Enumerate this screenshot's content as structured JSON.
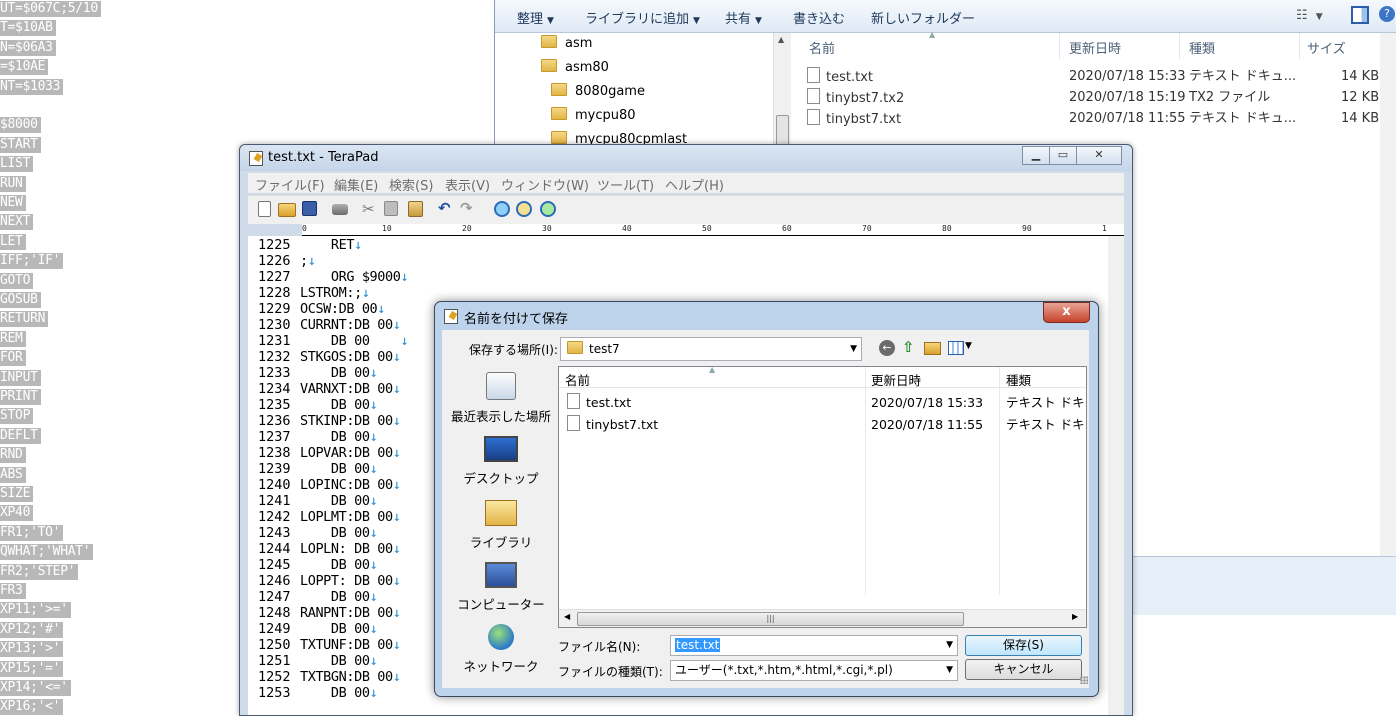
{
  "left_column": {
    "lines": [
      "UT=$067C;5/10",
      "T=$10AB",
      "N=$06A3",
      "=$10AE",
      "NT=$1033",
      "",
      "$8000",
      "START",
      "LIST",
      "RUN",
      "NEW",
      "NEXT",
      "LET",
      "IFF;'IF'",
      "GOTO",
      "GOSUB",
      "RETURN",
      "REM",
      "FOR",
      "INPUT",
      "PRINT",
      "STOP",
      "DEFLT",
      "RND",
      "ABS",
      "SIZE",
      "XP40",
      "FR1;'TO'",
      "QWHAT;'WHAT'",
      "FR2;'STEP'",
      "FR3",
      "XP11;'>='",
      "XP12;'#'",
      "XP13;'>'",
      "XP15;'='",
      "XP14;'<='",
      "XP16;'<'"
    ]
  },
  "explorer": {
    "toolbar": {
      "organize": "整理",
      "add_to_library": "ライブラリに追加",
      "share": "共有",
      "burn": "書き込む",
      "new_folder": "新しいフォルダー"
    },
    "tree": [
      "asm",
      "asm80",
      "8080game",
      "mycpu80",
      "mycpu80cpmlast"
    ],
    "columns": {
      "name": "名前",
      "date": "更新日時",
      "type": "種類",
      "size": "サイズ"
    },
    "files": [
      {
        "name": "test.txt",
        "date": "2020/07/18 15:33",
        "type": "テキスト ドキュ...",
        "size": "14 KB"
      },
      {
        "name": "tinybst7.tx2",
        "date": "2020/07/18 15:19",
        "type": "TX2 ファイル",
        "size": "12 KB"
      },
      {
        "name": "tinybst7.txt",
        "date": "2020/07/18 11:55",
        "type": "テキスト ドキュ...",
        "size": "14 KB"
      }
    ]
  },
  "terapad": {
    "title": "test.txt - TeraPad",
    "menus": [
      "ファイル(F)",
      "編集(E)",
      "検索(S)",
      "表示(V)",
      "ウィンドウ(W)",
      "ツール(T)",
      "ヘルプ(H)"
    ],
    "ruler_labels": [
      "0",
      "10",
      "20",
      "30",
      "40",
      "50",
      "60",
      "70",
      "80",
      "90",
      "1"
    ],
    "eol_mark": "↓",
    "lines": [
      {
        "num": "1225",
        "text": "    RET"
      },
      {
        "num": "1226",
        "text": ";"
      },
      {
        "num": "1227",
        "text": "    ORG $9000"
      },
      {
        "num": "1228",
        "text": "LSTROM:;"
      },
      {
        "num": "1229",
        "text": "OCSW:DB 00"
      },
      {
        "num": "1230",
        "text": "CURRNT:DB 00"
      },
      {
        "num": "1231",
        "text": "    DB 00    "
      },
      {
        "num": "1232",
        "text": "STKGOS:DB 00"
      },
      {
        "num": "1233",
        "text": "    DB 00"
      },
      {
        "num": "1234",
        "text": "VARNXT:DB 00"
      },
      {
        "num": "1235",
        "text": "    DB 00"
      },
      {
        "num": "1236",
        "text": "STKINP:DB 00"
      },
      {
        "num": "1237",
        "text": "    DB 00"
      },
      {
        "num": "1238",
        "text": "LOPVAR:DB 00"
      },
      {
        "num": "1239",
        "text": "    DB 00"
      },
      {
        "num": "1240",
        "text": "LOPINC:DB 00"
      },
      {
        "num": "1241",
        "text": "    DB 00"
      },
      {
        "num": "1242",
        "text": "LOPLMT:DB 00"
      },
      {
        "num": "1243",
        "text": "    DB 00"
      },
      {
        "num": "1244",
        "text": "LOPLN: DB 00"
      },
      {
        "num": "1245",
        "text": "    DB 00"
      },
      {
        "num": "1246",
        "text": "LOPPT: DB 00"
      },
      {
        "num": "1247",
        "text": "    DB 00"
      },
      {
        "num": "1248",
        "text": "RANPNT:DB 00"
      },
      {
        "num": "1249",
        "text": "    DB 00"
      },
      {
        "num": "1250",
        "text": "TXTUNF:DB 00"
      },
      {
        "num": "1251",
        "text": "    DB 00"
      },
      {
        "num": "1252",
        "text": "TXTBGN:DB 00"
      },
      {
        "num": "1253",
        "text": "    DB 00"
      }
    ]
  },
  "save_dialog": {
    "title": "名前を付けて保存",
    "close": "x",
    "look_in_label": "保存する場所(I):",
    "look_in_value": "test7",
    "places": [
      "最近表示した場所",
      "デスクトップ",
      "ライブラリ",
      "コンピューター",
      "ネットワーク"
    ],
    "columns": {
      "name": "名前",
      "date": "更新日時",
      "type": "種類"
    },
    "files": [
      {
        "name": "test.txt",
        "date": "2020/07/18 15:33",
        "type": "テキスト ドキ..."
      },
      {
        "name": "tinybst7.txt",
        "date": "2020/07/18 11:55",
        "type": "テキスト ドキ..."
      }
    ],
    "file_name_label": "ファイル名(N):",
    "file_name_value": "test.txt",
    "file_type_label": "ファイルの種類(T):",
    "file_type_value": "ユーザー(*.txt,*.htm,*.html,*.cgi,*.pl)",
    "save_button": "保存(S)",
    "cancel_button": "キャンセル"
  }
}
